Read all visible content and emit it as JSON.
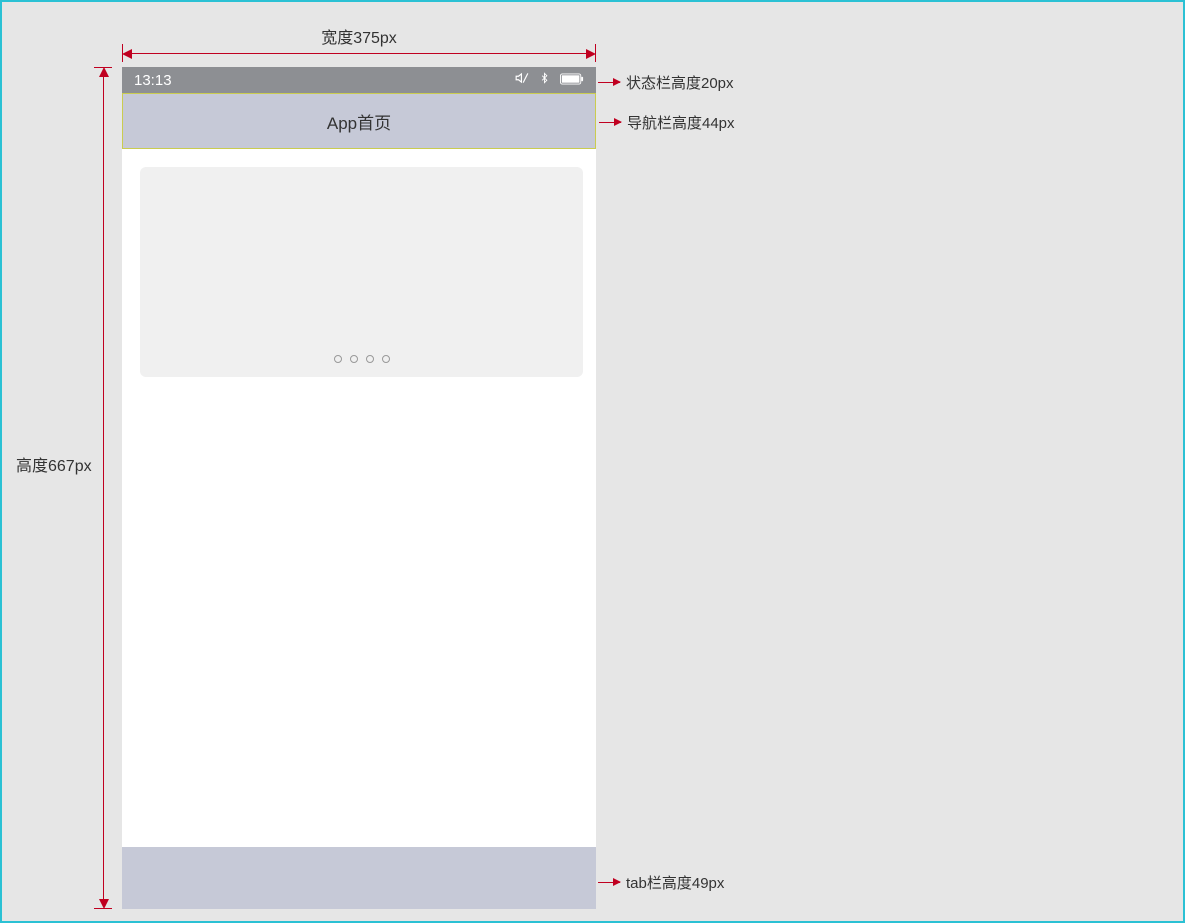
{
  "dimensions": {
    "width_label": "宽度375px",
    "height_label": "高度667px"
  },
  "callouts": {
    "status": "状态栏高度20px",
    "nav": "导航栏高度44px",
    "tab": "tab栏高度49px"
  },
  "status_bar": {
    "time": "13:13"
  },
  "nav_bar": {
    "title": "App首页"
  }
}
